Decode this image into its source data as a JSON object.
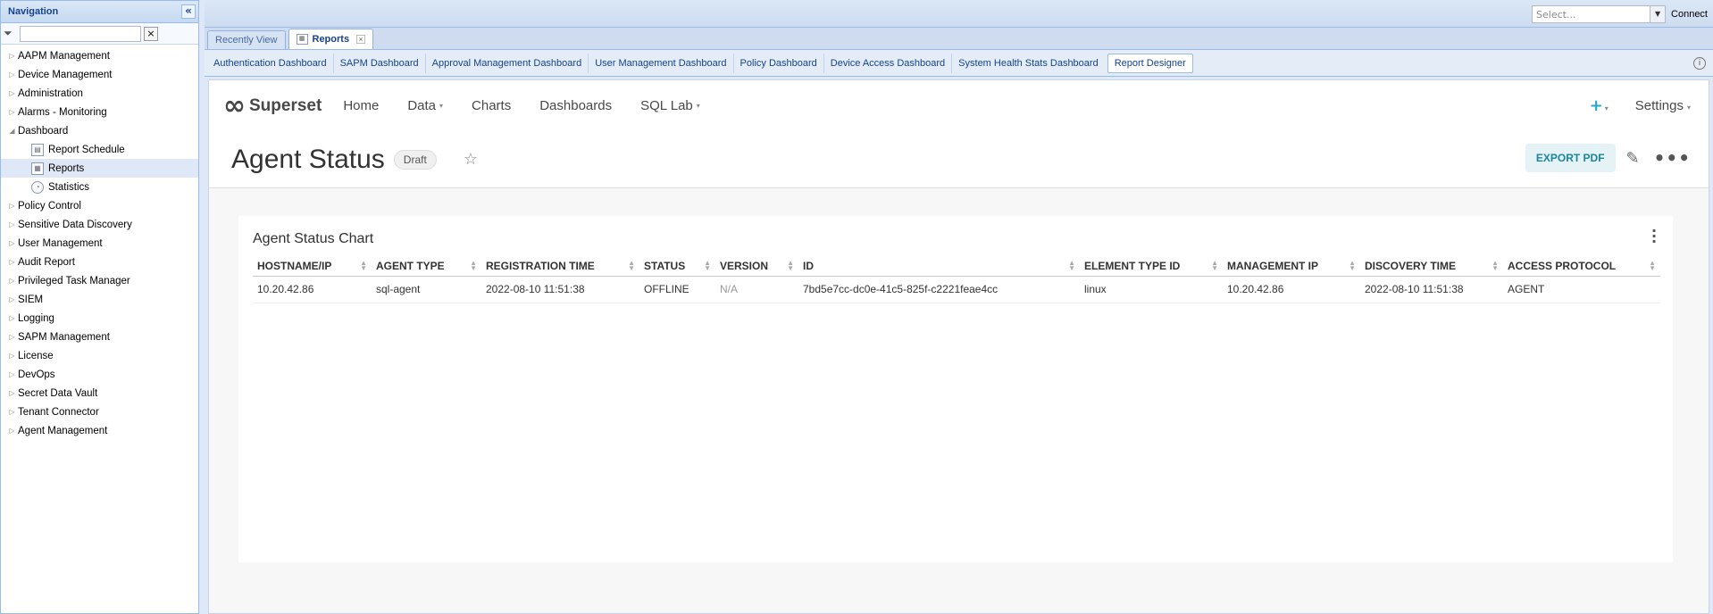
{
  "nav": {
    "title": "Navigation",
    "collapse_icon": "double-chevron-left",
    "filter_placeholder": "",
    "clear_label": "×",
    "items": [
      {
        "label": "AAPM Management",
        "expanded": false
      },
      {
        "label": "Device Management",
        "expanded": false
      },
      {
        "label": "Administration",
        "expanded": false
      },
      {
        "label": "Alarms - Monitoring",
        "expanded": false
      },
      {
        "label": "Dashboard",
        "expanded": true
      },
      {
        "label": "Report Schedule",
        "child": true
      },
      {
        "label": "Reports",
        "child": true,
        "selected": true
      },
      {
        "label": "Statistics",
        "child": true
      },
      {
        "label": "Policy Control",
        "expanded": false
      },
      {
        "label": "Sensitive Data Discovery",
        "expanded": false
      },
      {
        "label": "User Management",
        "expanded": false
      },
      {
        "label": "Audit Report",
        "expanded": false
      },
      {
        "label": "Privileged Task Manager",
        "expanded": false
      },
      {
        "label": "SIEM",
        "expanded": false
      },
      {
        "label": "Logging",
        "expanded": false
      },
      {
        "label": "SAPM Management",
        "expanded": false
      },
      {
        "label": "License",
        "expanded": false
      },
      {
        "label": "DevOps",
        "expanded": false
      },
      {
        "label": "Secret Data Vault",
        "expanded": false
      },
      {
        "label": "Tenant Connector",
        "expanded": false
      },
      {
        "label": "Agent Management",
        "expanded": false
      }
    ]
  },
  "topbar": {
    "select_placeholder": "Select...",
    "connect_label": "Connect"
  },
  "tabs": {
    "recent": "Recently View",
    "reports": "Reports"
  },
  "subtabs": [
    "Authentication Dashboard",
    "SAPM Dashboard",
    "Approval Management Dashboard",
    "User Management Dashboard",
    "Policy Dashboard",
    "Device Access Dashboard",
    "System Health Stats Dashboard",
    "Report Designer"
  ],
  "superset": {
    "brand": "Superset",
    "menu": {
      "home": "Home",
      "data": "Data",
      "charts": "Charts",
      "dashboards": "Dashboards",
      "sqllab": "SQL Lab"
    },
    "plus": "+",
    "settings": "Settings"
  },
  "dashboard": {
    "title": "Agent Status",
    "badge": "Draft",
    "export_label": "EXPORT PDF",
    "more_label": "•••"
  },
  "chart": {
    "title": "Agent Status Chart",
    "columns": [
      "HOSTNAME/IP",
      "AGENT TYPE",
      "REGISTRATION TIME",
      "STATUS",
      "VERSION",
      "ID",
      "ELEMENT TYPE ID",
      "MANAGEMENT IP",
      "DISCOVERY TIME",
      "ACCESS PROTOCOL"
    ],
    "rows": [
      [
        "10.20.42.86",
        "sql-agent",
        "2022-08-10 11:51:38",
        "OFFLINE",
        "N/A",
        "7bd5e7cc-dc0e-41c5-825f-c2221feae4cc",
        "linux",
        "10.20.42.86",
        "2022-08-10 11:51:38",
        "AGENT"
      ]
    ]
  },
  "colors": {
    "ext_header": "#15428b",
    "superset_accent": "#20a7c9",
    "border": "#99bbe8"
  }
}
